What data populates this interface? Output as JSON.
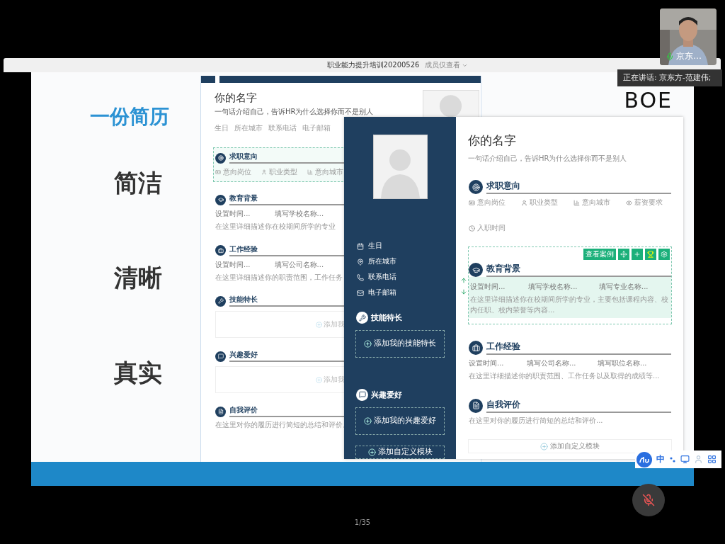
{
  "meeting": {
    "title": "职业能力提升培训20200526",
    "view_mode": "成员仅查看"
  },
  "slide": {
    "heading": "一份简历",
    "keywords": [
      "简洁",
      "清晰",
      "真实"
    ],
    "logo": "BOE",
    "back_resume": {
      "name": "你的名字",
      "intro": "一句话介绍自己，告诉HR为什么选择你而不是别人",
      "contacts": [
        "生日",
        "所在城市",
        "联系电话",
        "电子邮箱"
      ],
      "sections": [
        {
          "kind": "fields",
          "title": "求职意向",
          "selected": true,
          "fields": [
            "意向岗位",
            "职业类型",
            "意向城市"
          ]
        },
        {
          "kind": "entry",
          "title": "教育背景",
          "selected": false,
          "columns": [
            "设置时间...",
            "填写学校名称..."
          ],
          "description": "在这里详细描述你在校期间所学的专业"
        },
        {
          "kind": "entry",
          "title": "工作经验",
          "selected": false,
          "columns": [
            "设置时间...",
            "填写公司名称..."
          ],
          "description": "在这里详细描述你的职责范围，工作任务"
        },
        {
          "kind": "add",
          "title": "技能特长",
          "selected": false,
          "action": "添加我"
        },
        {
          "kind": "add",
          "title": "兴趣爱好",
          "selected": false,
          "action": "添加我"
        },
        {
          "kind": "text",
          "title": "自我评价",
          "selected": false,
          "description": "在这里对你的履历进行简短的总结和评价。"
        }
      ]
    },
    "front_resume": {
      "sidebar": {
        "contacts": [
          "生日",
          "所在城市",
          "联系电话",
          "电子邮箱"
        ],
        "sections": [
          {
            "title": "技能特长",
            "action": "添加我的技能特长"
          },
          {
            "title": "兴趣爱好",
            "action": "添加我的兴趣爱好"
          }
        ],
        "custom_action": "添加自定义模块"
      },
      "main": {
        "name": "你的名字",
        "intro": "一句话介绍自己，告诉HR为什么选择你而不是别人",
        "sections": [
          {
            "kind": "fields",
            "title": "求职意向",
            "selected": false,
            "fields": [
              "意向岗位",
              "职业类型",
              "意向城市",
              "薪资要求",
              "入职时间"
            ]
          },
          {
            "kind": "entry",
            "title": "教育背景",
            "selected": true,
            "columns": [
              "设置时间...",
              "填写学校名称...",
              "填写专业名称..."
            ],
            "description": "在这里详细描述你在校期间所学的专业，主要包括课程内容、校内任职、校内荣誉等内容..."
          },
          {
            "kind": "entry",
            "title": "工作经验",
            "selected": false,
            "columns": [
              "设置时间...",
              "填写公司名称...",
              "填写职位名称..."
            ],
            "description": "在这里详细描述你的职责范围、工作任务以及取得的成绩等..."
          },
          {
            "kind": "text",
            "title": "自我评价",
            "selected": false,
            "description": "在这里对你的履历进行简短的总结和评价..."
          }
        ],
        "example_button": "查看案例",
        "custom_action": "添加自定义模块"
      }
    }
  },
  "page_counter": "1/35",
  "camera": {
    "label": "京东…"
  },
  "speaker": "正在讲话: 京东方-范建伟;",
  "ime": {
    "mode": "中"
  }
}
